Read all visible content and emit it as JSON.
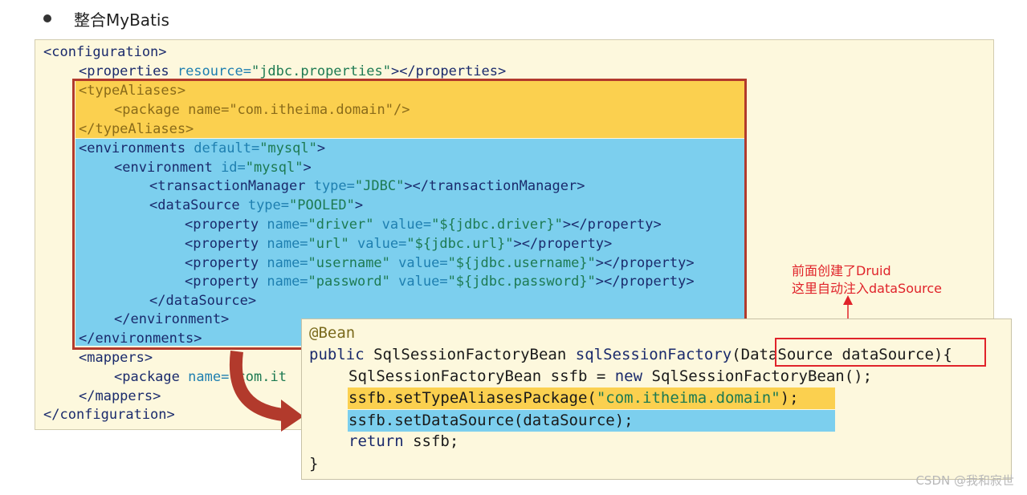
{
  "heading": {
    "text": "整合MyBatis"
  },
  "xml": {
    "l1_open": "<configuration>",
    "l2_open": "<properties ",
    "l2_attr": "resource=",
    "l2_val": "\"jdbc.properties\"",
    "l2_close": "></properties>",
    "l3": "<typeAliases>",
    "l4_open": "<package ",
    "l4_attr": "name=",
    "l4_val": "\"com.itheima.domain\"",
    "l4_close": "/>",
    "l5": "</typeAliases>",
    "l6_open": "<environments ",
    "l6_attr": "default=",
    "l6_val": "\"mysql\"",
    "l6_close": ">",
    "l7_open": "<environment ",
    "l7_attr": "id=",
    "l7_val": "\"mysql\"",
    "l7_close": ">",
    "l8_open": "<transactionManager ",
    "l8_attr": "type=",
    "l8_val": "\"JDBC\"",
    "l8_close": "></transactionManager>",
    "l9_open": "<dataSource ",
    "l9_attr": "type=",
    "l9_val": "\"POOLED\"",
    "l9_close": ">",
    "p1_open": "<property ",
    "p1_a1": "name=",
    "p1_v1": "\"driver\"",
    "p1_a2": " value=",
    "p1_v2": "\"${jdbc.driver}\"",
    "p1_close": "></property>",
    "p2_open": "<property ",
    "p2_a1": "name=",
    "p2_v1": "\"url\"",
    "p2_a2": " value=",
    "p2_v2": "\"${jdbc.url}\"",
    "p2_close": "></property>",
    "p3_open": "<property ",
    "p3_a1": "name=",
    "p3_v1": "\"username\"",
    "p3_a2": " value=",
    "p3_v2": "\"${jdbc.username}\"",
    "p3_close": "></property>",
    "p4_open": "<property ",
    "p4_a1": "name=",
    "p4_v1": "\"password\"",
    "p4_a2": " value=",
    "p4_v2": "\"${jdbc.password}\"",
    "p4_close": "></property>",
    "l14": "</dataSource>",
    "l15": "</environment>",
    "l16": "</environments>",
    "l17": "<mappers>",
    "l18_open": "<package ",
    "l18_attr": "name=",
    "l18_val": "\"com.it",
    "l19": "</mappers>",
    "l20": "</configuration>"
  },
  "java": {
    "annotation": "@Bean",
    "sig_kw": "public ",
    "sig_type": "SqlSessionFactoryBean ",
    "sig_method": "sqlSessionFactory",
    "sig_paren": "(",
    "sig_param": "DataSource dataSource",
    "sig_end": "){",
    "line3_a": "SqlSessionFactoryBean ssfb = ",
    "line3_kw": "new",
    "line3_b": " SqlSessionFactoryBean();",
    "line4_a": "ssfb.setTypeAliasesPackage(",
    "line4_str": "\"com.itheima.domain\"",
    "line4_b": ");",
    "line5": "ssfb.setDataSource(dataSource);",
    "line6_kw": "return",
    "line6_b": " ssfb;",
    "line7": "}"
  },
  "note": {
    "line1": "前面创建了Druid",
    "line2": "这里自动注入dataSource"
  },
  "watermark": "CSDN @我和寂世",
  "colors": {
    "highlight_yellow": "#fbd04f",
    "highlight_blue": "#7ccfee",
    "frame_red": "#b23a2c",
    "note_red": "#e0232a",
    "panel_bg": "#fdf8dd"
  }
}
